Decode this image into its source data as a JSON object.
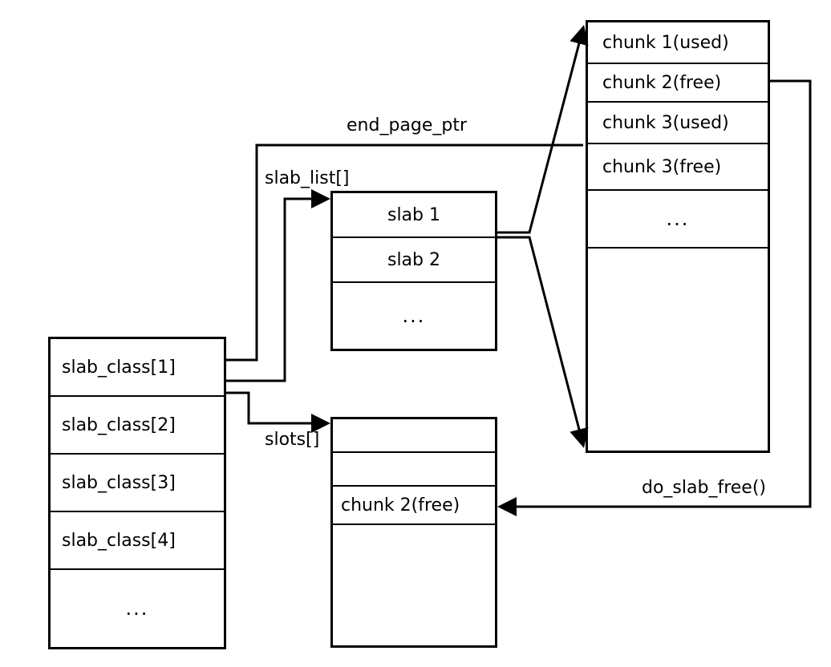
{
  "labels": {
    "end_page_ptr": "end_page_ptr",
    "slab_list": "slab_list[]",
    "slots": "slots[]",
    "do_slab_free": "do_slab_free()"
  },
  "slab_classes": {
    "items": [
      "slab_class[1]",
      "slab_class[2]",
      "slab_class[3]",
      "slab_class[4]"
    ],
    "ellipsis": "..."
  },
  "slab_list_box": {
    "items": [
      "slab 1",
      "slab 2"
    ],
    "ellipsis": "..."
  },
  "chunks_box": {
    "items": [
      "chunk 1(used)",
      "chunk 2(free)",
      "chunk 3(used)",
      "chunk 3(free)"
    ],
    "ellipsis": "..."
  },
  "slots_box": {
    "chunk_label": "chunk 2(free)"
  }
}
